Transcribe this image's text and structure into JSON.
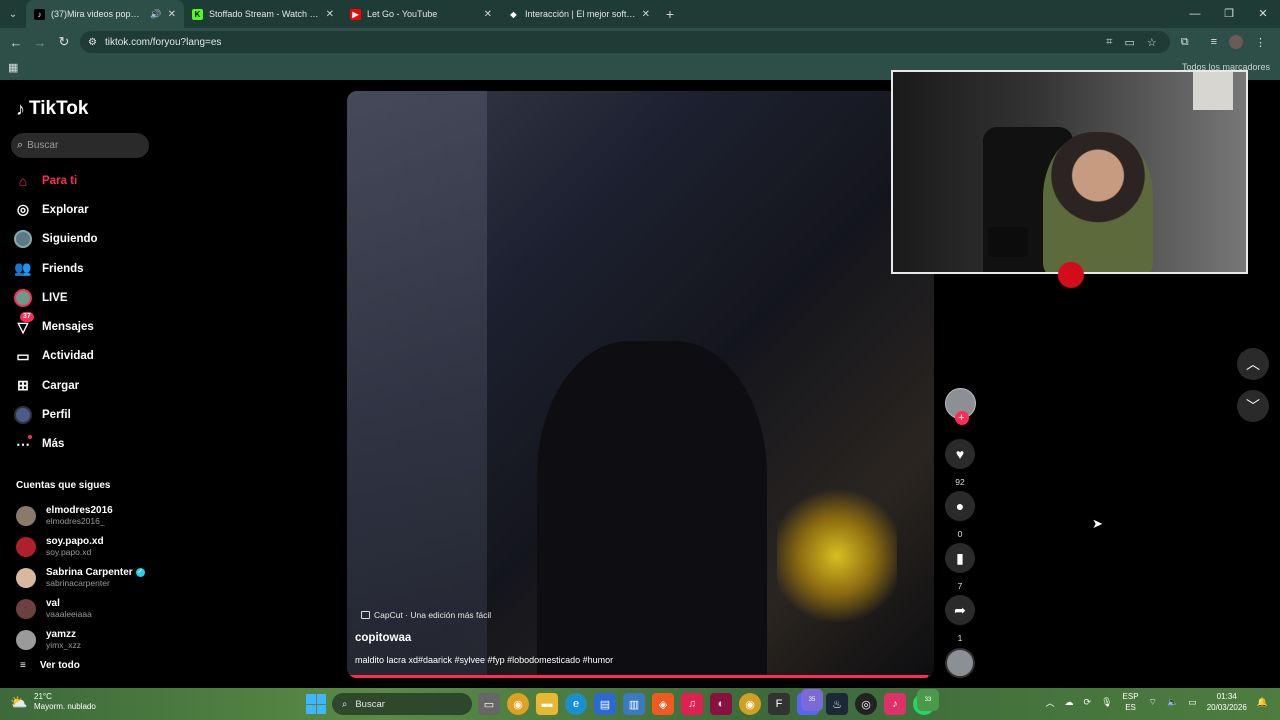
{
  "browser": {
    "tabs": [
      {
        "title": "(37)Mira videos populares",
        "active": true,
        "favicon": "tiktok-icon",
        "color": "#000000"
      },
      {
        "title": "Stoffado Stream - Watch Live on",
        "active": false,
        "favicon": "kick-icon",
        "color": "#53fc18"
      },
      {
        "title": "Let Go - YouTube",
        "active": false,
        "favicon": "youtube-icon",
        "color": "#ff0000"
      },
      {
        "title": "Interacción | El mejor software pa",
        "active": false,
        "favicon": "diamond-icon",
        "color": "#ffffff"
      }
    ],
    "url": "tiktok.com/foryou?lang=es",
    "bookmarks_all": "Todos los marcadores"
  },
  "tiktok": {
    "brand": "TikTok",
    "search_placeholder": "Buscar",
    "nav": [
      {
        "label": "Para ti",
        "icon": "home-icon",
        "active": true
      },
      {
        "label": "Explorar",
        "icon": "compass-icon"
      },
      {
        "label": "Siguiendo",
        "icon": "following-avatar-icon"
      },
      {
        "label": "Friends",
        "icon": "friends-icon"
      },
      {
        "label": "LIVE",
        "icon": "live-icon"
      },
      {
        "label": "Mensajes",
        "icon": "messages-icon",
        "badge": "37"
      },
      {
        "label": "Actividad",
        "icon": "activity-icon"
      },
      {
        "label": "Cargar",
        "icon": "upload-icon"
      },
      {
        "label": "Perfil",
        "icon": "profile-icon"
      },
      {
        "label": "Más",
        "icon": "more-icon"
      }
    ],
    "following_title": "Cuentas que sigues",
    "following": [
      {
        "name": "elmodres2016",
        "handle": "elmodres2016_",
        "color": "#8a7a6a"
      },
      {
        "name": "soy.papo.xd",
        "handle": "soy.papo.xd",
        "color": "#b0202a"
      },
      {
        "name": "Sabrina Carpenter",
        "handle": "sabrinacarpenter",
        "color": "#d9b8a0",
        "verified": true
      },
      {
        "name": "val",
        "handle": "vaaaleeiaaa",
        "color": "#6a4040"
      },
      {
        "name": "yamzz",
        "handle": "yimx_xzz",
        "color": "#9a9a9a"
      }
    ],
    "see_all": "Ver todo",
    "video": {
      "capcut": "CapCut · Una edición más fácil",
      "author": "copitowaa",
      "description": "maldito lacra xd#daarick #sylvee #fyp #lobodomesticado #humor",
      "progress": 0.99
    },
    "actions": {
      "likes": "92",
      "comments": "0",
      "saves": "7",
      "shares": "1"
    }
  },
  "taskbar": {
    "temp": "21°C",
    "weather": "Mayorm. nublado",
    "search": "Buscar",
    "lang1": "ESP",
    "lang2": "ES",
    "time": "01:34",
    "date": "20/03/2026",
    "discord_badge": "35",
    "whatsapp_badge": "33"
  }
}
